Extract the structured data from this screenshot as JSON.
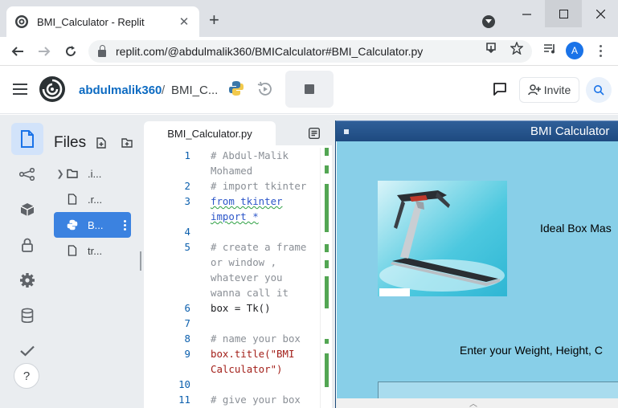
{
  "browser": {
    "tab_title": "BMI_Calculator - Replit",
    "tab_close": "✕",
    "new_tab": "+",
    "url": "replit.com/@abdulmalik360/BMICalculator#BMI_Calculator.py",
    "avatar_letter": "A"
  },
  "header": {
    "username": "abdulmalik360",
    "separator": "/",
    "repl_name": "BMI_C...",
    "invite_label": "Invite"
  },
  "sidebar": {
    "title": "Files",
    "items": [
      {
        "name": ".i...",
        "type": "folder"
      },
      {
        "name": ".r...",
        "type": "file"
      },
      {
        "name": "B...",
        "type": "python",
        "selected": true
      },
      {
        "name": "tr...",
        "type": "file"
      }
    ],
    "help_label": "?"
  },
  "editor": {
    "tab_label": "BMI_Calculator.py",
    "lines": [
      {
        "num": "1",
        "text": "# Abdul-Malik"
      },
      {
        "num": "",
        "text": "Mohamed"
      },
      {
        "num": "2",
        "text": "# import tkinter"
      },
      {
        "num": "3",
        "text": "from tkinter"
      },
      {
        "num": "",
        "text": "import *"
      },
      {
        "num": "4",
        "text": ""
      },
      {
        "num": "5",
        "text": "# create a frame"
      },
      {
        "num": "",
        "text": "or window ,"
      },
      {
        "num": "",
        "text": "whatever you"
      },
      {
        "num": "",
        "text": "wanna call it"
      },
      {
        "num": "6",
        "text": "box = Tk()"
      },
      {
        "num": "7",
        "text": ""
      },
      {
        "num": "8",
        "text": "# name your box"
      },
      {
        "num": "9",
        "text": "box.title(\"BMI"
      },
      {
        "num": "",
        "text": "Calculator\")"
      },
      {
        "num": "10",
        "text": ""
      },
      {
        "num": "11",
        "text": "# give your box"
      }
    ]
  },
  "tk_window": {
    "title": "BMI Calculator",
    "label_heading": "Ideal Box Mas",
    "label_prompt": "Enter your Weight, Height, C"
  },
  "colors": {
    "accent": "#0d6bc2",
    "selected_file": "#3b82e0",
    "tk_background": "#88cfe8",
    "tk_titlebar": "#1e4a80"
  }
}
